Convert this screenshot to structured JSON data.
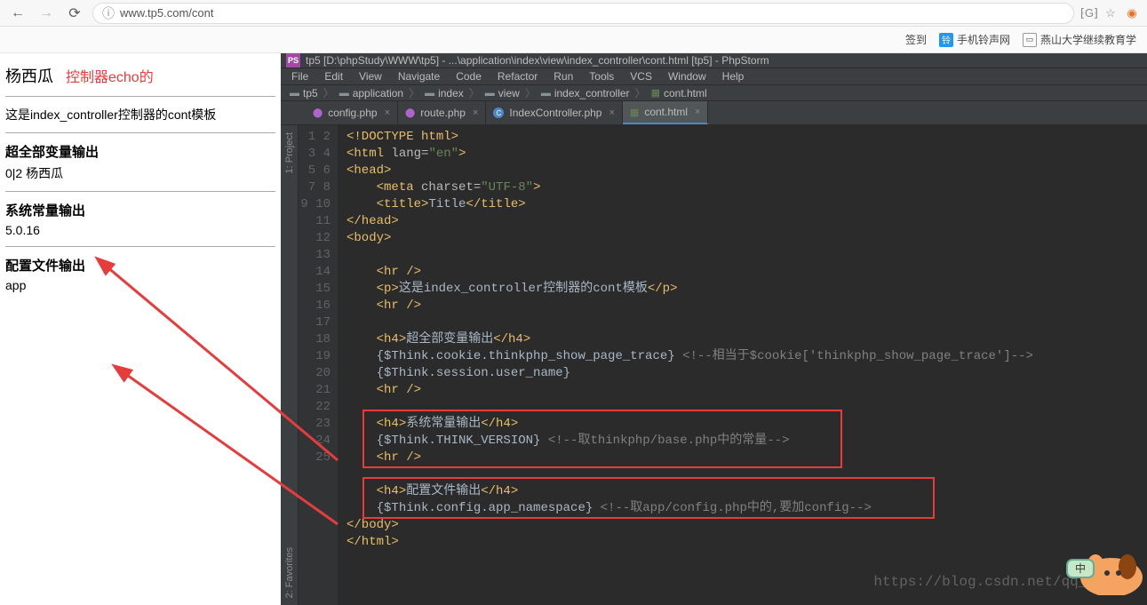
{
  "browser": {
    "url": "www.tp5.com/cont",
    "bookmarks": {
      "sign": "签到",
      "ring": "手机铃声网",
      "edu": "燕山大学继续教育学"
    }
  },
  "page": {
    "name": "杨西瓜",
    "echo_note": "控制器echo的",
    "desc": "这是index_controller控制器的cont模板",
    "h_super": "超全部变量输出",
    "super_val": "0|2 杨西瓜",
    "h_sys": "系统常量输出",
    "sys_val": "5.0.16",
    "h_conf": "配置文件输出",
    "conf_val": "app"
  },
  "ide": {
    "title": "tp5 [D:\\phpStudy\\WWW\\tp5] - ...\\application\\index\\view\\index_controller\\cont.html [tp5] - PhpStorm",
    "menu": [
      "File",
      "Edit",
      "View",
      "Navigate",
      "Code",
      "Refactor",
      "Run",
      "Tools",
      "VCS",
      "Window",
      "Help"
    ],
    "breadcrumb": [
      "tp5",
      "application",
      "index",
      "view",
      "index_controller",
      "cont.html"
    ],
    "tabs": [
      {
        "label": "config.php",
        "icon": "php"
      },
      {
        "label": "route.php",
        "icon": "php"
      },
      {
        "label": "IndexController.php",
        "icon": "class"
      },
      {
        "label": "cont.html",
        "icon": "html",
        "active": true
      }
    ],
    "sidebar": {
      "project": "1: Project",
      "favorites": "2: Favorites"
    },
    "code": {
      "l1": "<!DOCTYPE html>",
      "l2_open": "<html ",
      "l2_attr": "lang=",
      "l2_val": "\"en\"",
      "l2_close": ">",
      "l3": "<head>",
      "l4_open": "<meta ",
      "l4_attr": "charset=",
      "l4_val": "\"UTF-8\"",
      "l4_close": ">",
      "l5_open": "<title>",
      "l5_txt": "Title",
      "l5_close": "</title>",
      "l6": "</head>",
      "l7": "<body>",
      "l9": "<hr />",
      "l10_open": "<p>",
      "l10_txt": "这是index_controller控制器的cont模板",
      "l10_close": "</p>",
      "l11": "<hr />",
      "l13_open": "<h4>",
      "l13_txt": "超全部变量输出",
      "l13_close": "</h4>",
      "l14_tpl": "{$Think.cookie.thinkphp_show_page_trace}",
      "l14_cmt": " <!--相当于$cookie['thinkphp_show_page_trace']-->",
      "l15_tpl": "{$Think.session.user_name}",
      "l16": "<hr />",
      "l18_open": "<h4>",
      "l18_txt": "系统常量输出",
      "l18_close": "</h4>",
      "l19_tpl": "{$Think.THINK_VERSION}",
      "l19_cmt": " <!--取thinkphp/base.php中的常量-->",
      "l20": "<hr />",
      "l22_open": "<h4>",
      "l22_txt": "配置文件输出",
      "l22_close": "</h4>",
      "l23_tpl": "{$Think.config.app_namespace}",
      "l23_cmt": " <!--取app/config.php中的,要加config-->",
      "l24": "</body>",
      "l25": "</html>"
    }
  },
  "watermark": "https://blog.csdn.net/qq_338626"
}
